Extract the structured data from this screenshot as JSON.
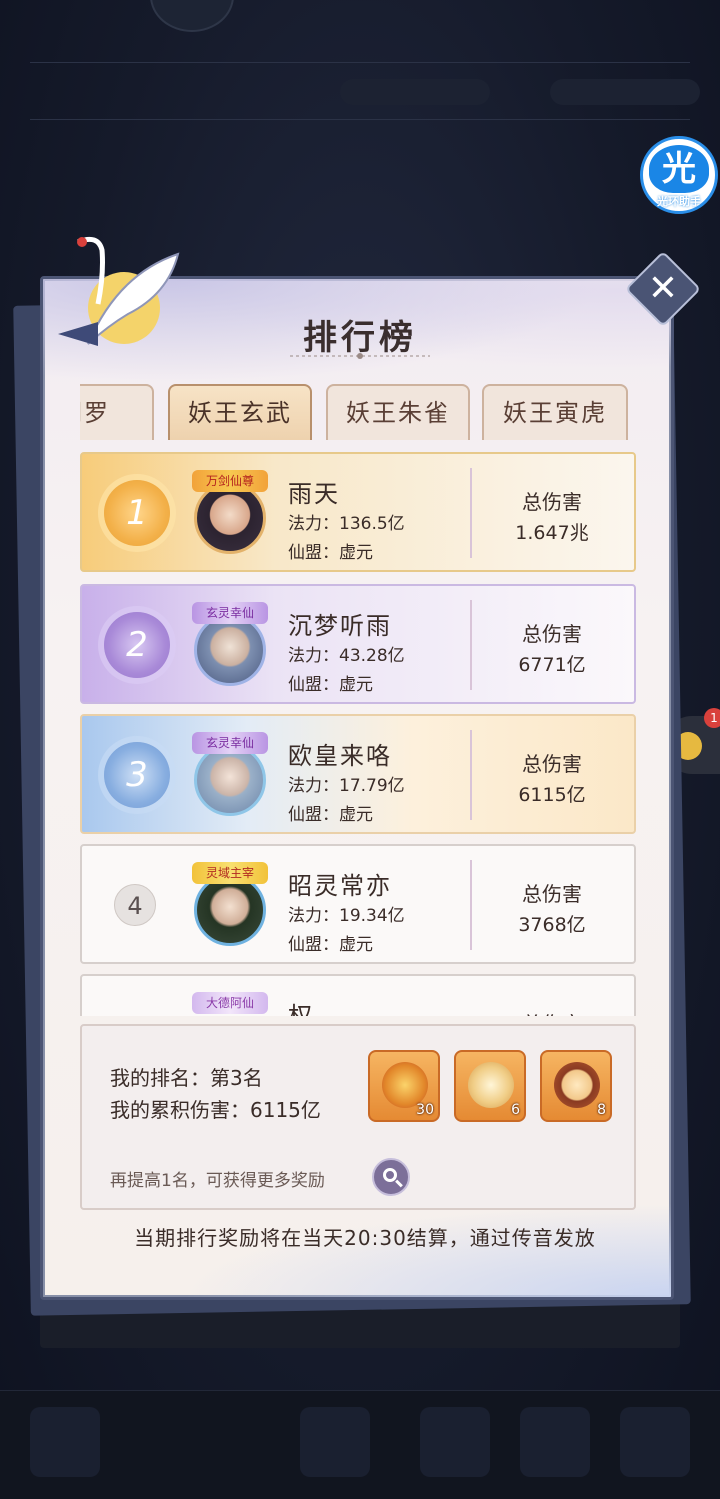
{
  "panel": {
    "title": "排行榜",
    "close_label": "✕"
  },
  "helper": {
    "icon_char": "光",
    "label": "光环助手"
  },
  "side_badge": {
    "count": "1"
  },
  "tabs": [
    {
      "label": "阎罗",
      "active": false
    },
    {
      "label": "妖王玄武",
      "active": true
    },
    {
      "label": "妖王朱雀",
      "active": false
    },
    {
      "label": "妖王寅虎",
      "active": false
    }
  ],
  "ranking": [
    {
      "rank": "1",
      "badge": "万剑仙尊",
      "name": "雨天",
      "power": "法力：136.5亿",
      "guild": "仙盟：虚元",
      "damage_label": "总伤害",
      "damage": "1.647兆"
    },
    {
      "rank": "2",
      "badge": "玄灵幸仙",
      "name": "沉梦听雨",
      "power": "法力：43.28亿",
      "guild": "仙盟：虚元",
      "damage_label": "总伤害",
      "damage": "6771亿"
    },
    {
      "rank": "3",
      "badge": "玄灵幸仙",
      "name": "欧皇来咯",
      "power": "法力：17.79亿",
      "guild": "仙盟：虚元",
      "damage_label": "总伤害",
      "damage": "6115亿"
    },
    {
      "rank": "4",
      "badge": "灵域主宰",
      "name": "昭灵常亦",
      "power": "法力：19.34亿",
      "guild": "仙盟：虚元",
      "damage_label": "总伤害",
      "damage": "3768亿"
    },
    {
      "rank": "",
      "badge": "大德阿仙",
      "name": "权",
      "power": "",
      "guild": "",
      "damage_label": "总伤害",
      "damage": ""
    }
  ],
  "my_rank": {
    "rank_text": "我的排名：第3名",
    "damage_text": "我的累积伤害：6115亿",
    "tip": "再提高1名，可获得更多奖励"
  },
  "rewards": [
    {
      "icon": "gold-ingot-bag-icon",
      "count": "30"
    },
    {
      "icon": "jade-scroll-icon",
      "count": "6"
    },
    {
      "icon": "mirror-artifact-icon",
      "count": "8"
    }
  ],
  "footer_note": "当期排行奖励将在当天20:30结算，通过传音发放",
  "colors": {
    "panel_bg": "#f6f0ec",
    "gold_rank": "#f3b14a",
    "silver_rank": "#a98ad8",
    "bronze_rank": "#88aee0",
    "reward_orange": "#e58a33"
  }
}
